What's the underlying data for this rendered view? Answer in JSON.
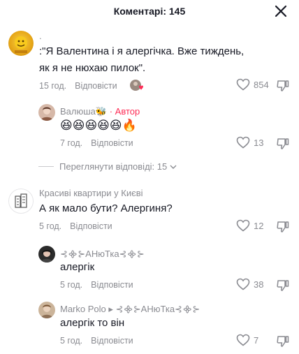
{
  "header": {
    "title": "Коментарі: 145"
  },
  "comments": [
    {
      "author": ".",
      "text": ":\"Я Валентина і я алергічка. Вже тиждень, як я не нюхаю пилок\".",
      "time": "15 год.",
      "reply_label": "Відповісти",
      "likes": "854",
      "liked_by_creator": true
    },
    {
      "author": "Валюша🐝",
      "author_tag": "· Автор",
      "text": "😆😆😆😆😆🔥",
      "time": "7 год.",
      "reply_label": "Відповісти",
      "likes": "13"
    }
  ],
  "view_replies": {
    "label": "Переглянути відповіді: 15"
  },
  "comments2": [
    {
      "author": "Красиві квартири у Києві",
      "text": "А як мало бути? Алергиня?",
      "time": "5 год.",
      "reply_label": "Відповісти",
      "likes": "12"
    },
    {
      "author": "⊰᯽⊱АНюТка⊰᯽⊱",
      "text": "алергік",
      "time": "5 год.",
      "reply_label": "Відповісти",
      "likes": "38"
    },
    {
      "author": "Marko Polo ▸ ⊰᯽⊱АНюТка⊰᯽⊱",
      "text": "алергік то він",
      "time": "5 год.",
      "reply_label": "Відповісти",
      "likes": "7"
    }
  ],
  "icons": {
    "close": "close-icon",
    "like": "heart-outline-icon",
    "dislike": "thumbs-down-icon",
    "expand": "chevron-down-icon"
  },
  "colors": {
    "accent": "#fe2c55",
    "muted": "#8a8b91",
    "text": "#161823"
  }
}
